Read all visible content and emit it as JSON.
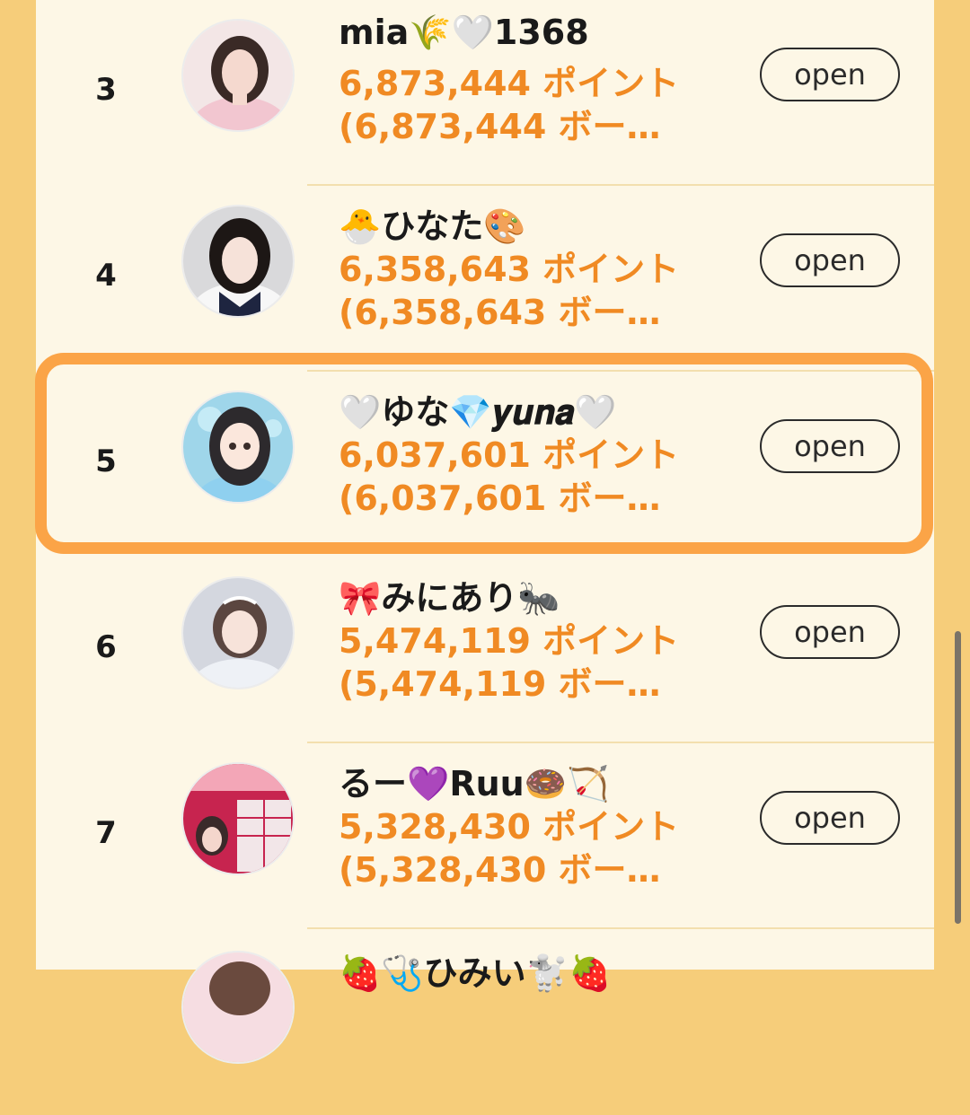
{
  "ranking": [
    {
      "rank": "3",
      "name": "mia🌾🤍1368",
      "points": "6,873,444 ポイント",
      "bonus": "(6,873,444 ボー…",
      "button": "open"
    },
    {
      "rank": "4",
      "name": "🐣ひなた🎨",
      "points": "6,358,643 ポイント",
      "bonus": "(6,358,643 ボー…",
      "button": "open"
    },
    {
      "rank": "5",
      "name": "🤍ゆな💎𝒚𝒖𝒏𝒂🤍",
      "points": "6,037,601 ポイント",
      "bonus": "(6,037,601 ボー…",
      "button": "open",
      "highlighted": true
    },
    {
      "rank": "6",
      "name": "🎀みにあり🐜",
      "points": "5,474,119 ポイント",
      "bonus": "(5,474,119 ボー…",
      "button": "open"
    },
    {
      "rank": "7",
      "name": "るー💜Ruu🍩🏹",
      "points": "5,328,430 ポイント",
      "bonus": "(5,328,430 ボー…",
      "button": "open"
    }
  ],
  "partial_next_row": {
    "name": "🍓🩺ひみい🐩🍓"
  },
  "colors": {
    "background": "#f6cd7a",
    "panel": "#fdf7e6",
    "points": "#f08a23",
    "highlight": "#fba447"
  }
}
